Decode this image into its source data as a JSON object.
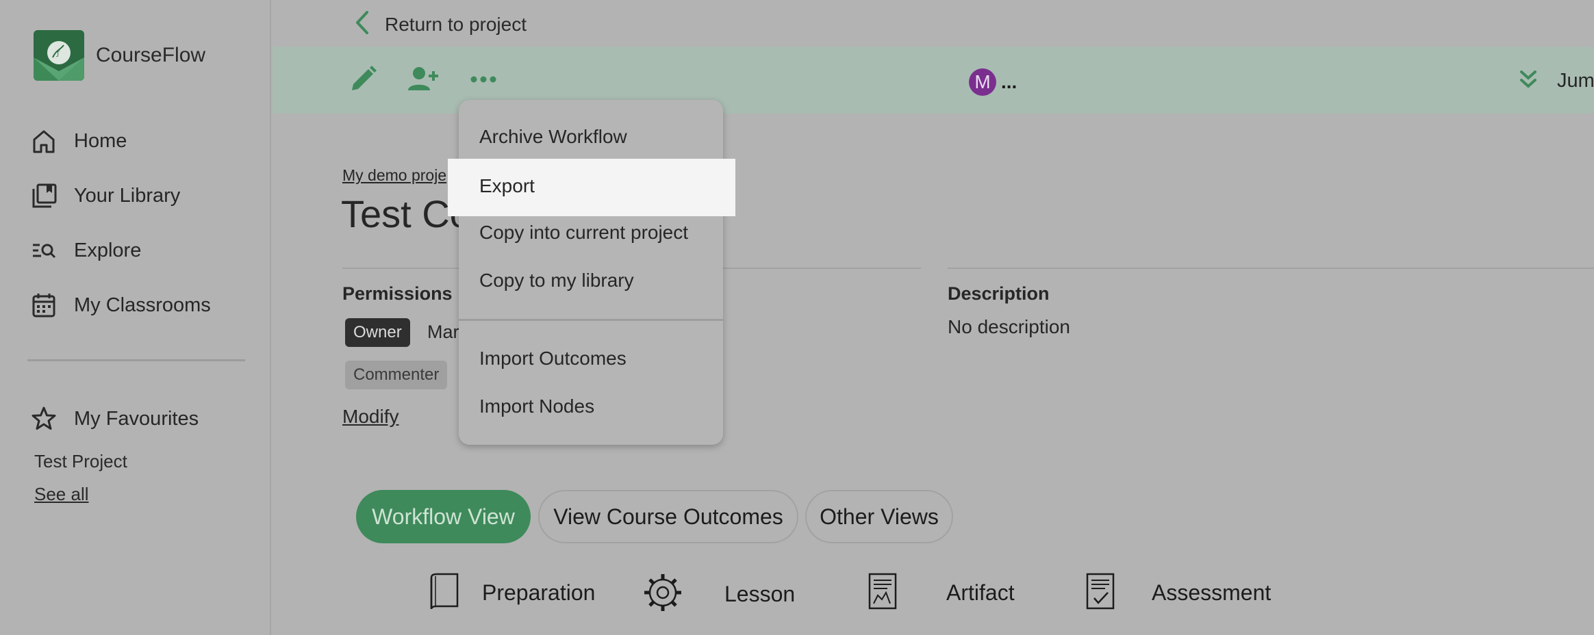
{
  "app": {
    "name": "CourseFlow"
  },
  "sidebar": {
    "items": [
      {
        "label": "Home",
        "icon": "home-icon"
      },
      {
        "label": "Your Library",
        "icon": "library-icon"
      },
      {
        "label": "Explore",
        "icon": "explore-icon"
      },
      {
        "label": "My Classrooms",
        "icon": "calendar-icon"
      }
    ],
    "favourites": {
      "label": "My Favourites",
      "icon": "star-icon",
      "entries": [
        "Test Project"
      ],
      "see_all": "See all"
    }
  },
  "header": {
    "return_label": "Return to project",
    "toolbar_icons": [
      "pencil-icon",
      "add-user-icon",
      "more-icon"
    ],
    "avatar_letter": "M",
    "avatar_more": "...",
    "avatar_color": "#7a2f8f",
    "jump_label": "Jum"
  },
  "main": {
    "breadcrumb": "My demo proje",
    "title": "Test Co",
    "permissions": {
      "heading": "Permissions",
      "owner_badge": "Owner",
      "owner_name": "Mar",
      "commenter_badge": "Commenter",
      "modify": "Modify"
    },
    "description": {
      "heading": "Description",
      "text": "No description"
    },
    "view_tabs": [
      "Workflow View",
      "View Course Outcomes",
      "Other Views"
    ],
    "node_types": [
      "Preparation",
      "Lesson",
      "Artifact",
      "Assessment"
    ]
  },
  "dropdown": {
    "items": [
      "Archive Workflow",
      "Export",
      "Copy into current project",
      "Copy to my library",
      "Import Outcomes",
      "Import Nodes"
    ],
    "highlighted": "Export"
  },
  "colors": {
    "accent": "#3e8a5b",
    "toolbar_bg": "#a9bcb2"
  }
}
